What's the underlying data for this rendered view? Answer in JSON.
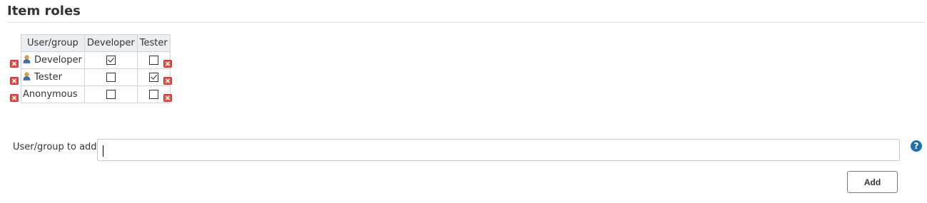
{
  "section": {
    "title": "Item roles"
  },
  "table": {
    "headers": {
      "user": "User/group",
      "roles": [
        "Developer",
        "Tester"
      ]
    },
    "rows": [
      {
        "name": "Developer",
        "icon": "user-icon",
        "developer": true,
        "tester": false
      },
      {
        "name": "Tester",
        "icon": "user-icon",
        "developer": false,
        "tester": true
      },
      {
        "name": "Anonymous",
        "icon": "",
        "developer": false,
        "tester": false
      }
    ]
  },
  "add_user": {
    "label": "User/group to add",
    "value": "",
    "help": "?",
    "button_label": "Add"
  },
  "colors": {
    "delete_red": "#d9534f",
    "help_blue": "#1f6fa8",
    "header_bg": "#ebeff2"
  }
}
